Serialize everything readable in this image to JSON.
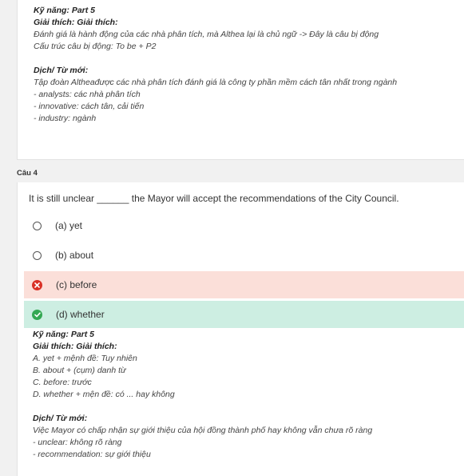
{
  "prev": {
    "skill_line": "Kỹ năng: Part 5",
    "explain_heading": "Giải thích: Giải thích:",
    "explain_lines": [
      "Đánh giá là hành động của các nhà phân tích, mà Althea lại là chủ ngữ -> Đây là câu bị động",
      "Cấu trúc câu bị động: To be + P2"
    ],
    "trans_heading": "Dịch/ Từ mới:",
    "trans_lines": [
      "Tập đoàn Altheađược các nhà phân tích đánh giá là công ty phần mềm cách tân nhất trong ngành",
      "- analysts: các nhà phân tích",
      "- innovative: cách tân, cải tiến",
      "- industry: ngành"
    ]
  },
  "question": {
    "label": "Câu 4",
    "text": "It is still unclear ______ the Mayor will accept the recommendations of the City Council.",
    "options": [
      {
        "label": "(a) yet",
        "state": "none"
      },
      {
        "label": "(b) about",
        "state": "none"
      },
      {
        "label": "(c) before",
        "state": "wrong"
      },
      {
        "label": "(d) whether",
        "state": "correct"
      }
    ]
  },
  "explanation": {
    "skill_line": "Kỹ năng: Part 5",
    "explain_heading": "Giải thích: Giải thích:",
    "explain_lines": [
      "A. yet + mệnh đề: Tuy nhiên",
      "B. about + (cụm) danh từ",
      "C. before: trước",
      "D. whether + mện đề: có ... hay không"
    ],
    "trans_heading": "Dịch/ Từ mới:",
    "trans_lines": [
      "Việc Mayor có chấp nhận sự giới thiệu của hội đồng thành phố hay không vẫn chưa rõ ràng",
      "- unclear: không rõ ràng",
      "- recommendation: sự giới thiệu"
    ]
  },
  "colors": {
    "wrong_bg": "#fbdfd9",
    "correct_bg": "#cdeee2",
    "wrong_icon": "#d93025",
    "correct_icon": "#34a853"
  },
  "icons": {
    "wrong": "x-circle-icon",
    "correct": "check-circle-icon",
    "unselected": "radio-empty-icon"
  }
}
